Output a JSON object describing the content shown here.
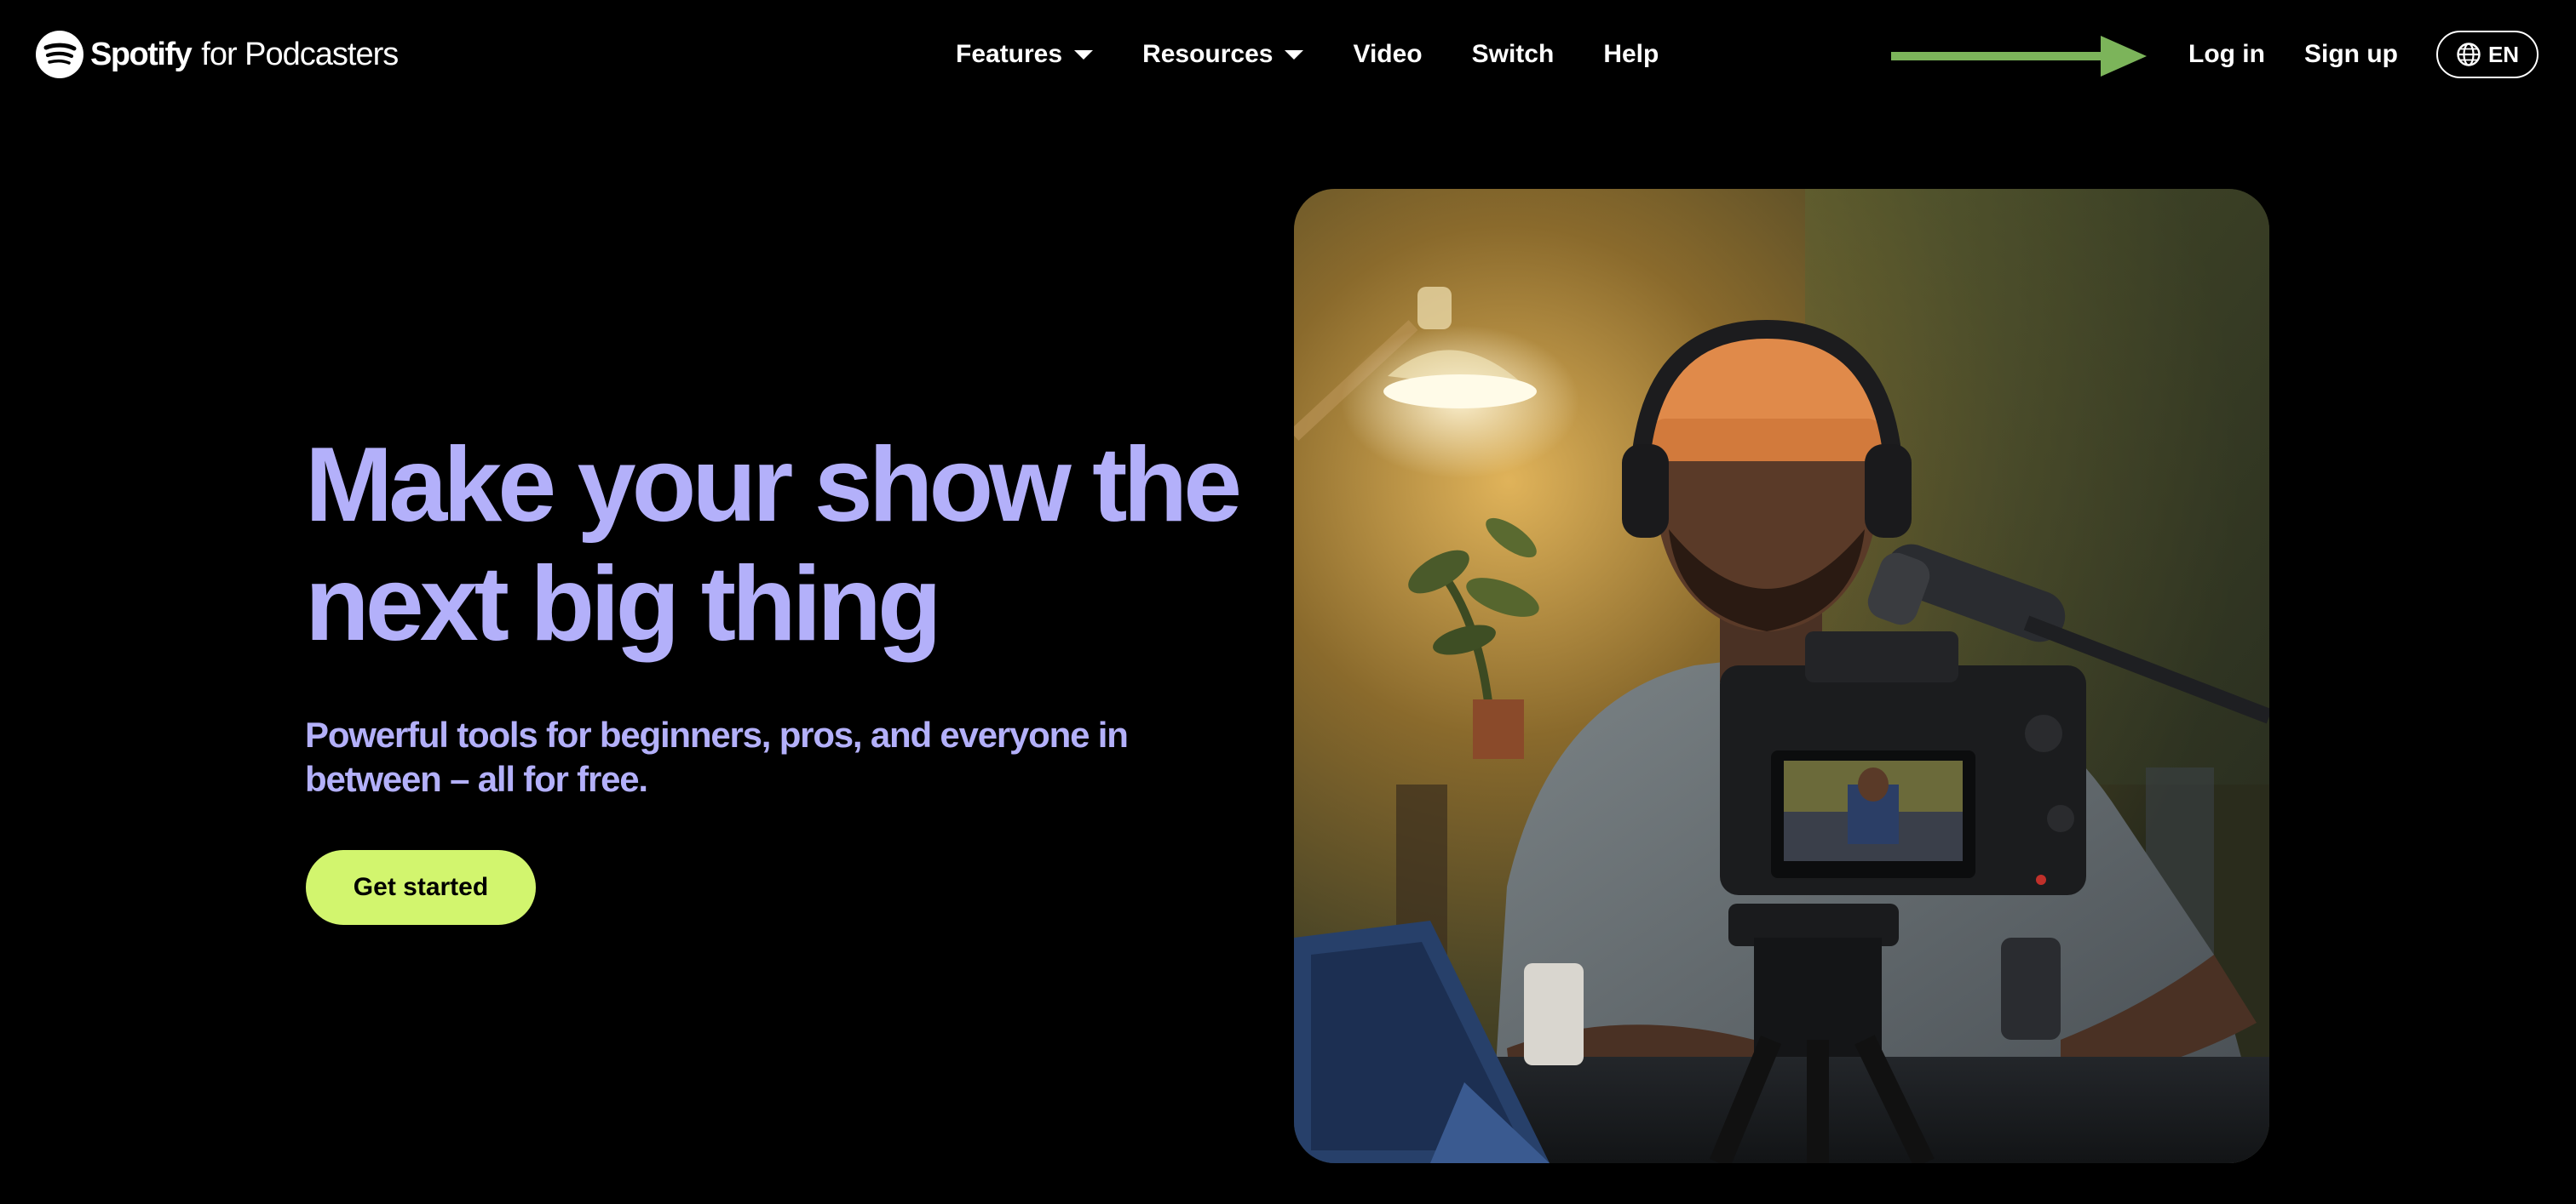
{
  "header": {
    "logo": {
      "brand": "Spotify",
      "suffix": "for Podcasters",
      "icon": "spotify-logo-icon"
    },
    "nav": [
      {
        "label": "Features",
        "has_dropdown": true
      },
      {
        "label": "Resources",
        "has_dropdown": true
      },
      {
        "label": "Video",
        "has_dropdown": false
      },
      {
        "label": "Switch",
        "has_dropdown": false
      },
      {
        "label": "Help",
        "has_dropdown": false
      }
    ],
    "auth": {
      "login_label": "Log in",
      "signup_label": "Sign up"
    },
    "language": {
      "label": "EN",
      "icon": "globe-icon"
    },
    "annotation_arrow": {
      "color": "#7cb45a",
      "points_to": "Log in"
    }
  },
  "hero": {
    "title_line1": "Make your show the",
    "title_line2": "next big thing",
    "subtitle_line1": "Powerful tools for beginners, pros, and everyone in",
    "subtitle_line2": "between – all for free.",
    "cta_label": "Get started",
    "image": "podcaster-recording-photo"
  },
  "colors": {
    "background": "#000000",
    "headline": "#b3b0fa",
    "cta_background": "#d2f56e",
    "cta_text": "#000000",
    "nav_text": "#ffffff"
  }
}
